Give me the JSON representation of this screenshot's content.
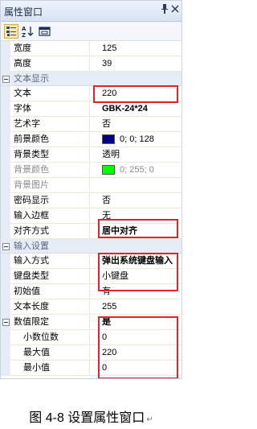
{
  "panel": {
    "title": "属性窗口",
    "pin_icon": "pin-icon",
    "close_icon": "close-icon"
  },
  "toolbar": {
    "buttons": [
      "categorized-icon",
      "alphabetical-icon",
      "property-pages-icon"
    ]
  },
  "rows_top": [
    {
      "name": "宽度",
      "value": "125"
    },
    {
      "name": "高度",
      "value": "39"
    }
  ],
  "categories": {
    "text_display": "文本显示",
    "input_settings": "输入设置"
  },
  "text_display": [
    {
      "name": "文本",
      "value": "220"
    },
    {
      "name": "字体",
      "value": "GBK-24*24"
    },
    {
      "name": "艺术字",
      "value": "否"
    },
    {
      "name": "前景颜色",
      "value": "0; 0; 128",
      "color": "#000080"
    },
    {
      "name": "背景类型",
      "value": "透明"
    },
    {
      "name": "背景颜色",
      "value": "0; 255; 0",
      "color": "#00ff00"
    },
    {
      "name": "背景图片",
      "value": ""
    },
    {
      "name": "密码显示",
      "value": "否"
    },
    {
      "name": "输入边框",
      "value": "无"
    },
    {
      "name": "对齐方式",
      "value": "居中对齐"
    }
  ],
  "input_settings": [
    {
      "name": "输入方式",
      "value": "弹出系统键盘输入"
    },
    {
      "name": "键盘类型",
      "value": "小键盘"
    },
    {
      "name": "初始值",
      "value": "有"
    },
    {
      "name": "文本长度",
      "value": "255"
    },
    {
      "name": "数值限定",
      "value": "是"
    },
    {
      "name": "小数位数",
      "value": "0"
    },
    {
      "name": "最大值",
      "value": "220"
    },
    {
      "name": "最小值",
      "value": "0"
    }
  ],
  "caption": "图 4-8 设置属性窗口",
  "caption_mark": "↵",
  "colors": {
    "highlight": "#e0232d",
    "gutter": "#e6ecf5",
    "grid_line": "#ece9d8"
  }
}
